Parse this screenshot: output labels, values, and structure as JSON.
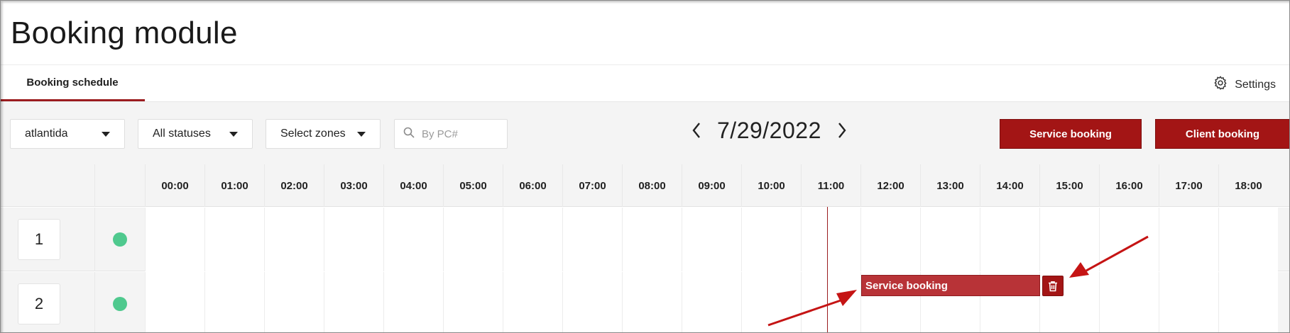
{
  "page": {
    "title": "Booking module"
  },
  "tabs": {
    "active_label": "Booking schedule",
    "settings_label": "Settings"
  },
  "filters": {
    "club": "atlantida",
    "status": "All statuses",
    "zones": "Select zones",
    "search_placeholder": "By PC#"
  },
  "date_nav": {
    "date": "7/29/2022"
  },
  "actions": {
    "service_booking": "Service booking",
    "client_booking": "Client booking"
  },
  "schedule": {
    "hours": [
      "00:00",
      "01:00",
      "02:00",
      "03:00",
      "04:00",
      "05:00",
      "06:00",
      "07:00",
      "08:00",
      "09:00",
      "10:00",
      "11:00",
      "12:00",
      "13:00",
      "14:00",
      "15:00",
      "16:00",
      "17:00",
      "18:00"
    ],
    "rows": [
      {
        "pc": "1",
        "status": "online"
      },
      {
        "pc": "2",
        "status": "online"
      }
    ],
    "booking": {
      "label": "Service booking",
      "pc": "2",
      "start": "12:00",
      "end": "15:00"
    }
  },
  "colors": {
    "accent": "#a31515",
    "status_online": "#4fc98e",
    "booking": "#b83337"
  }
}
